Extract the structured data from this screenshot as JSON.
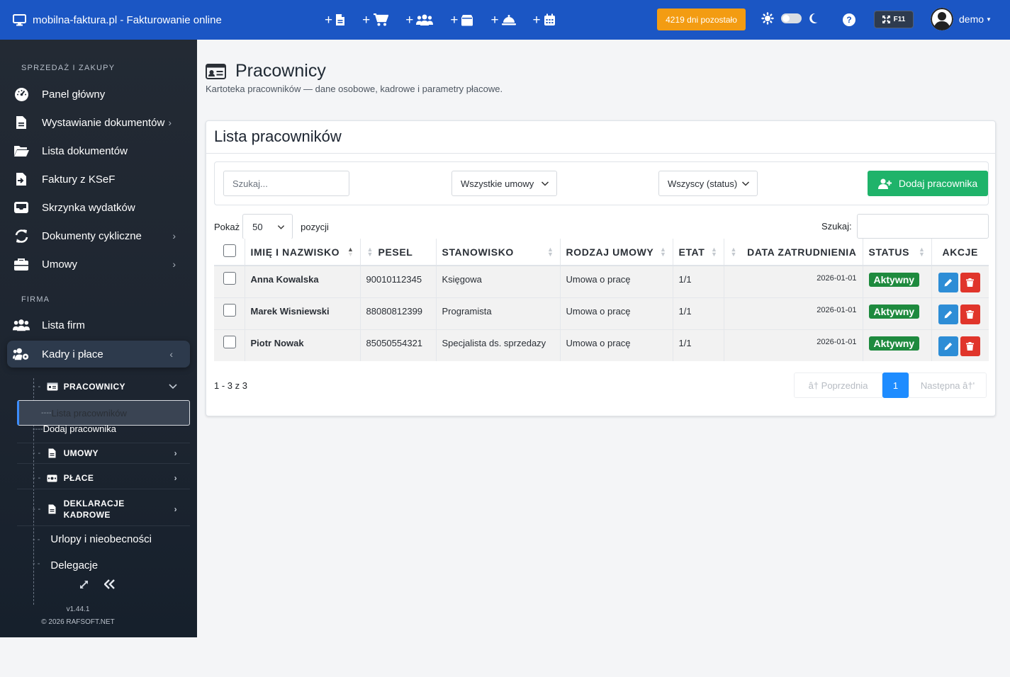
{
  "topbar": {
    "title": "mobilna-faktura.pl - Fakturowanie online",
    "quick_icons": [
      "document-icon",
      "cart-icon",
      "users-icon",
      "box-icon",
      "service-bell-icon",
      "calendar-icon"
    ],
    "plus": "+",
    "days_left": "4219 dni pozostało",
    "help": "?",
    "fullscreen_key": "F11",
    "user": "demo",
    "accent": "#1b56c4",
    "days_color": "#f39c12"
  },
  "sidebar": {
    "section_sales": "SPRZEDAŻ I ZAKUPY",
    "items": [
      {
        "label": "Panel główny",
        "icon": "gauge-icon"
      },
      {
        "label": "Wystawianie dokumentów",
        "icon": "file-icon"
      },
      {
        "label": "Lista dokumentów",
        "icon": "folder-icon"
      },
      {
        "label": "Faktury z KSeF",
        "icon": "file-import-icon"
      },
      {
        "label": "Skrzynka wydatków",
        "icon": "inbox-icon"
      },
      {
        "label": "Dokumenty cykliczne",
        "icon": "sync-icon"
      },
      {
        "label": "Umowy",
        "icon": "briefcase-icon"
      }
    ],
    "section_company": "FIRMA",
    "company_items": [
      {
        "label": "Lista firm",
        "icon": "users-icon"
      },
      {
        "label": "Kadry i płace",
        "icon": "users-cog-icon"
      }
    ],
    "hr": {
      "pracownicy": "PRACOWNICY",
      "lista": "Lista pracowników",
      "dodaj": "Dodaj pracownika",
      "umowy": "UMOWY",
      "place": "PŁACE",
      "deklaracje1": "DEKLARACJE",
      "deklaracje2": "KADROWE",
      "urlopy": "Urlopy i nieobecności",
      "delegacje": "Delegacje"
    },
    "dash": "- -",
    "leaf_dash": "----",
    "version": "v1.44.1",
    "copyright": "© 2026 RAFSOFT.NET"
  },
  "page": {
    "title": "Pracownicy",
    "subtitle": "Kartoteka pracowników — dane osobowe, kadrowe i parametry płacowe."
  },
  "card": {
    "title": "Lista pracowników",
    "search_placeholder": "Szukaj...",
    "filter_contract": "Wszystkie umowy",
    "filter_status": "Wszyscy (status)",
    "add_button": "Dodaj pracownika",
    "show_label": "Pokaż",
    "page_size": "50",
    "entries_label": "pozycji",
    "search_label": "Szukaj:",
    "columns": [
      "IMIĘ I NAZWISKO",
      "PESEL",
      "STANOWISKO",
      "RODZAJ UMOWY",
      "ETAT",
      "DATA ZATRUDNIENIA",
      "STATUS",
      "AKCJE"
    ],
    "rows": [
      {
        "name": "Anna Kowalska",
        "pesel": "90010112345",
        "position": "Księgowa",
        "contract": "Umowa o pracę",
        "etat": "1/1",
        "date": "2026-01-01",
        "status": "Aktywny"
      },
      {
        "name": "Marek Wisniewski",
        "pesel": "88080812399",
        "position": "Programista",
        "contract": "Umowa o pracę",
        "etat": "1/1",
        "date": "2026-01-01",
        "status": "Aktywny"
      },
      {
        "name": "Piotr Nowak",
        "pesel": "85050554321",
        "position": "Specjalista ds. sprzedazy",
        "contract": "Umowa o pracę",
        "etat": "1/1",
        "date": "2026-01-01",
        "status": "Aktywny"
      }
    ],
    "info": "1 - 3 z 3",
    "prev": "â† Poprzednia",
    "page": "1",
    "next": "Następna â†'"
  }
}
